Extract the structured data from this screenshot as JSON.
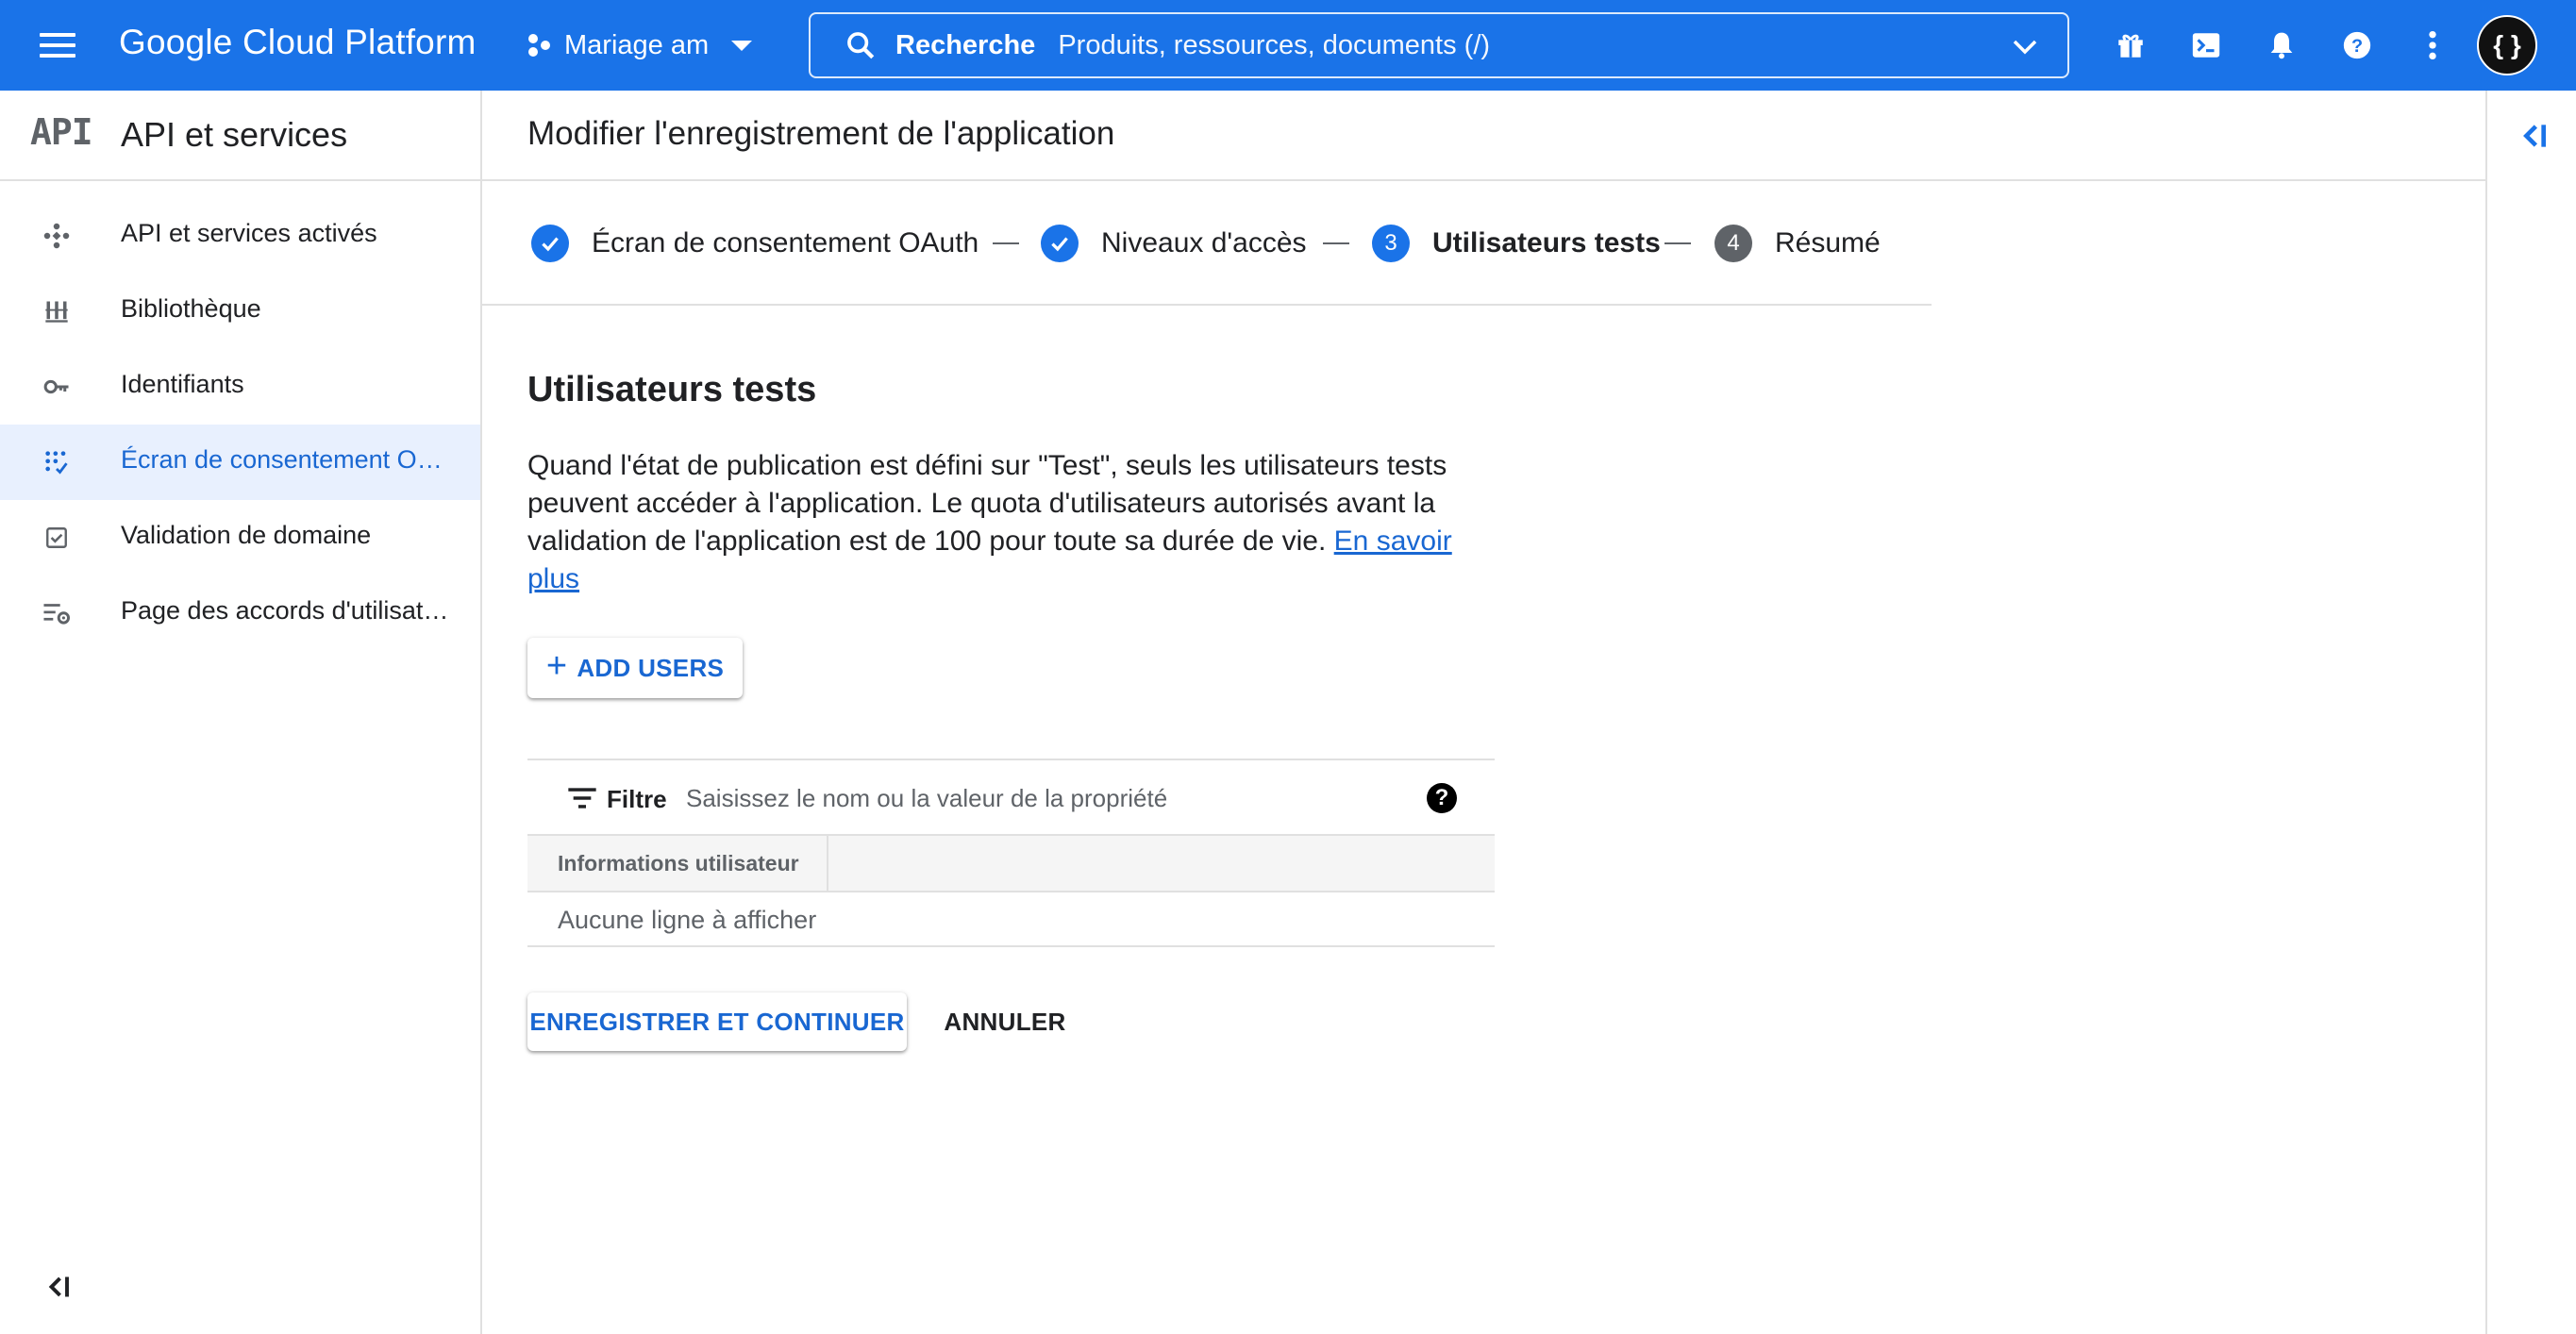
{
  "topbar": {
    "brand": "Google Cloud Platform",
    "project": "Mariage am",
    "search_label": "Recherche",
    "search_placeholder": "Produits, ressources, documents (/)",
    "avatar_text": "{ }"
  },
  "icons": {
    "menu": "hamburger-icon",
    "project": "project-dots-icon",
    "search": "search-icon",
    "gift": "gift-icon",
    "terminal": "cloud-shell-icon",
    "notifications": "bell-icon",
    "help": "help-icon",
    "more": "more-vert-icon"
  },
  "sidebar": {
    "logo": "API",
    "title": "API et services",
    "items": [
      {
        "label": "API et services activés",
        "icon": "api-diamond-icon",
        "active": false
      },
      {
        "label": "Bibliothèque",
        "icon": "library-icon",
        "active": false
      },
      {
        "label": "Identifiants",
        "icon": "key-icon",
        "active": false
      },
      {
        "label": "Écran de consentement OAuth",
        "icon": "consent-grid-icon",
        "active": true
      },
      {
        "label": "Validation de domaine",
        "icon": "checkbox-icon",
        "active": false
      },
      {
        "label": "Page des accords d'utilisation",
        "icon": "settings-list-icon",
        "active": false
      }
    ]
  },
  "main": {
    "page_title": "Modifier l'enregistrement de l'application",
    "steps": [
      {
        "marker": "✓",
        "label": "Écran de consentement OAuth",
        "state": "done"
      },
      {
        "marker": "✓",
        "label": "Niveaux d'accès",
        "state": "done"
      },
      {
        "marker": "3",
        "label": "Utilisateurs tests",
        "state": "current"
      },
      {
        "marker": "4",
        "label": "Résumé",
        "state": "pending"
      }
    ],
    "section_title": "Utilisateurs tests",
    "description": "Quand l'état de publication est défini sur \"Test\", seuls les utilisateurs tests peuvent accéder à l'application. Le quota d'utilisateurs autorisés avant la validation de l'application est de 100 pour toute sa durée de vie.",
    "learn_more": "En savoir plus",
    "add_users_label": "ADD USERS",
    "filter_label": "Filtre",
    "filter_placeholder": "Saisissez le nom ou la valeur de la propriété",
    "filter_help": "?",
    "table_column": "Informations utilisateur",
    "table_empty": "Aucune ligne à afficher",
    "save_label": "ENREGISTRER ET CONTINUER",
    "cancel_label": "ANNULER"
  },
  "colors": {
    "brand": "#1a73e8",
    "active_text": "#1967d2",
    "active_bg": "#e8f0fe"
  }
}
